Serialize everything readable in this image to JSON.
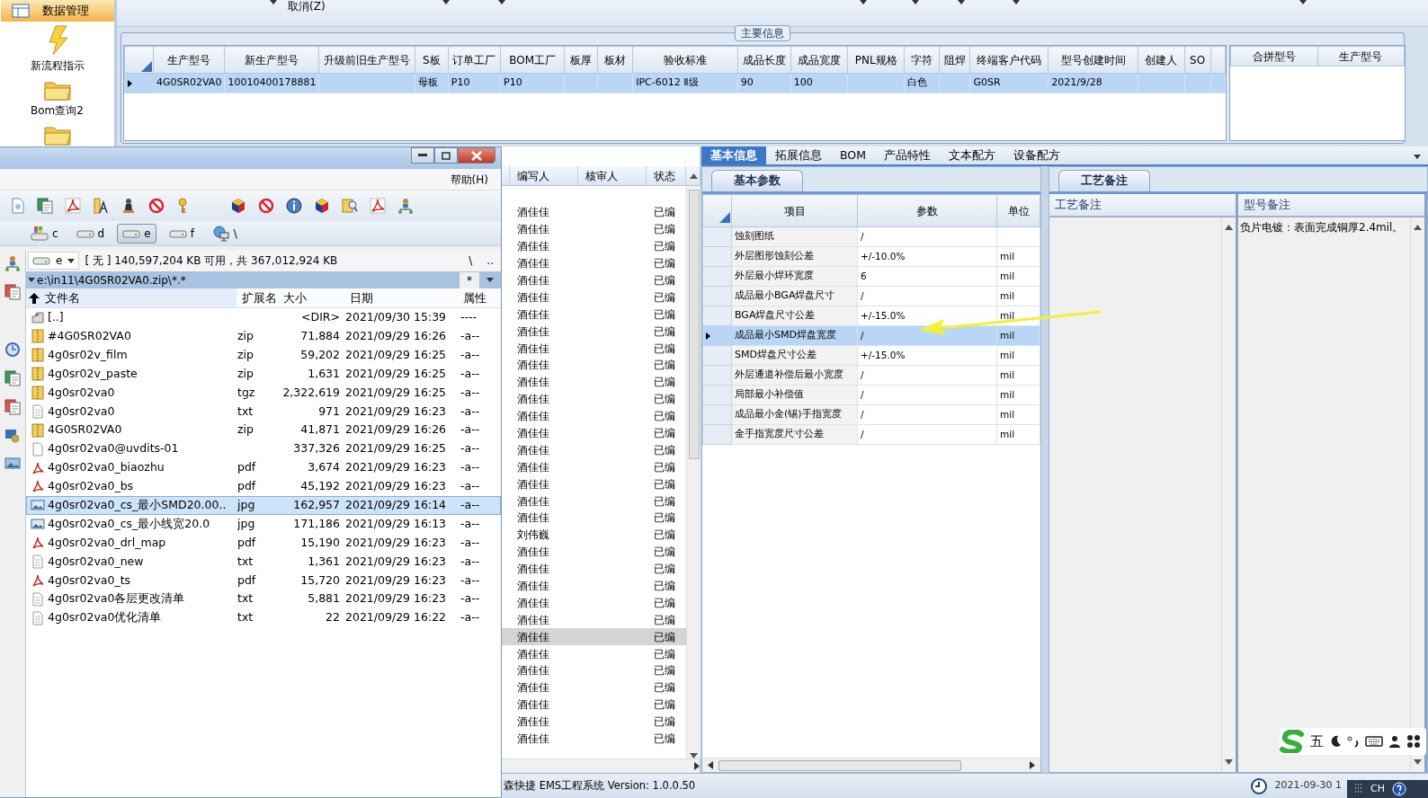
{
  "sidebar": {
    "header": "数据管理",
    "items": [
      {
        "label": "新流程指示",
        "kind": "flash"
      },
      {
        "label": "Bom查询2",
        "kind": "folder"
      },
      {
        "kind": "folder"
      }
    ]
  },
  "toolbar": {
    "buttons": [
      "取消(Z)"
    ]
  },
  "main_info": {
    "title": "主要信息",
    "columns": [
      "生产型号",
      "新生产型号",
      "升级前旧生产型号",
      "S板",
      "订单工厂",
      "BOM工厂",
      "板厚",
      "板材",
      "验收标准",
      "成品长度",
      "成品宽度",
      "PNL规格",
      "字符",
      "阻焊",
      "终端客户代码",
      "型号创建时间",
      "创建人",
      "SO"
    ],
    "rows": [
      {
        "selected": true,
        "cells": [
          "4G0SR02VA0",
          "10010400178881",
          null,
          "母板",
          "P10",
          "P10",
          null,
          null,
          "IPC-6012 Ⅱ级",
          "90",
          "100",
          null,
          "白色",
          null,
          "G0SR",
          "2021/9/28",
          null,
          null
        ]
      }
    ]
  },
  "merge_grid": {
    "columns": [
      "合拼型号",
      "生产型号"
    ]
  },
  "review_list": {
    "columns": [
      "编写人",
      "核审人",
      "状态"
    ],
    "rows": [
      {
        "author": "酒佳佳",
        "status": "已编",
        "selected": false
      },
      {
        "author": "酒佳佳",
        "status": "已编",
        "selected": false
      },
      {
        "author": "酒佳佳",
        "status": "已编",
        "selected": false
      },
      {
        "author": "酒佳佳",
        "status": "已编",
        "selected": false
      },
      {
        "author": "酒佳佳",
        "status": "已编",
        "selected": false
      },
      {
        "author": "酒佳佳",
        "status": "已编",
        "selected": false
      },
      {
        "author": "酒佳佳",
        "status": "已编",
        "selected": false
      },
      {
        "author": "酒佳佳",
        "status": "已编",
        "selected": false
      },
      {
        "author": "酒佳佳",
        "status": "已编",
        "selected": false
      },
      {
        "author": "酒佳佳",
        "status": "已编",
        "selected": false
      },
      {
        "author": "酒佳佳",
        "status": "已编",
        "selected": false
      },
      {
        "author": "酒佳佳",
        "status": "已编",
        "selected": false
      },
      {
        "author": "酒佳佳",
        "status": "已编",
        "selected": false
      },
      {
        "author": "酒佳佳",
        "status": "已编",
        "selected": false
      },
      {
        "author": "酒佳佳",
        "status": "已编",
        "selected": false
      },
      {
        "author": "酒佳佳",
        "status": "已编",
        "selected": false
      },
      {
        "author": "酒佳佳",
        "status": "已编",
        "selected": false
      },
      {
        "author": "酒佳佳",
        "status": "已编",
        "selected": false
      },
      {
        "author": "酒佳佳",
        "status": "已编",
        "selected": false
      },
      {
        "author": "刘伟巍",
        "status": "已编",
        "selected": false
      },
      {
        "author": "酒佳佳",
        "status": "已编",
        "selected": false
      },
      {
        "author": "酒佳佳",
        "status": "已编",
        "selected": false
      },
      {
        "author": "酒佳佳",
        "status": "已编",
        "selected": false
      },
      {
        "author": "酒佳佳",
        "status": "已编",
        "selected": false
      },
      {
        "author": "酒佳佳",
        "status": "已编",
        "selected": false
      },
      {
        "author": "酒佳佳",
        "status": "已编",
        "selected": true
      },
      {
        "author": "酒佳佳",
        "status": "已编",
        "selected": false
      },
      {
        "author": "酒佳佳",
        "status": "已编",
        "selected": false
      },
      {
        "author": "酒佳佳",
        "status": "已编",
        "selected": false
      },
      {
        "author": "酒佳佳",
        "status": "已编",
        "selected": false
      },
      {
        "author": "酒佳佳",
        "status": "已编",
        "selected": false
      },
      {
        "author": "酒佳佳",
        "status": "已编",
        "selected": false
      }
    ]
  },
  "tabs": [
    {
      "label": "基本信息",
      "selected": true
    },
    {
      "label": "拓展信息",
      "selected": false
    },
    {
      "label": "BOM",
      "selected": false
    },
    {
      "label": "产品特性",
      "selected": false
    },
    {
      "label": "文本配方",
      "selected": false
    },
    {
      "label": "设备配方",
      "selected": false
    }
  ],
  "param_panel": {
    "subtab": "基本参数",
    "columns": [
      "项目",
      "参数",
      "单位"
    ],
    "rows": [
      {
        "item": "蚀刻图纸",
        "value": "/",
        "selected": false
      },
      {
        "item": "外层图形蚀刻公差",
        "value": "+/-10.0%",
        "unit": "mil",
        "selected": false
      },
      {
        "item": "外层最小焊环宽度",
        "value": "6",
        "unit": "mil",
        "selected": false
      },
      {
        "item": "成品最小BGA焊盘尺寸",
        "value": "/",
        "unit": "mil",
        "selected": false
      },
      {
        "item": "BGA焊盘尺寸公差",
        "value": "+/-15.0%",
        "unit": "mil",
        "selected": false
      },
      {
        "item": "成品最小SMD焊盘宽度",
        "value": "/",
        "unit": "mil",
        "selected": true
      },
      {
        "item": "SMD焊盘尺寸公差",
        "value": "+/-15.0%",
        "unit": "mil",
        "selected": false
      },
      {
        "item": "外层通道补偿后最小宽度",
        "value": "/",
        "unit": "mil",
        "selected": false
      },
      {
        "item": "局部最小补偿值",
        "value": "/",
        "unit": "mil",
        "selected": false
      },
      {
        "item": "成品最小金(锡)手指宽度",
        "value": "/",
        "unit": "mil",
        "selected": false
      },
      {
        "item": "金手指宽度尺寸公差",
        "value": "/",
        "unit": "mil",
        "selected": false
      }
    ]
  },
  "notes_panel": {
    "tab": "工艺备注",
    "columns": [
      "工艺备注",
      "型号备注"
    ],
    "model_note": "负片电镀：表面完成铜厚2.4mil。"
  },
  "status_bar": {
    "app": "森快捷 EMS工程系统 Version: 1.0.0.50",
    "time": "2021-09-30 1"
  },
  "ime_bar": {
    "mode": "五"
  },
  "tray": {
    "language": "CH"
  },
  "file_manager": {
    "menu": [
      "帮助(H)"
    ],
    "drives": [
      {
        "label": "c",
        "kind": "system",
        "selected": false
      },
      {
        "label": "d",
        "kind": "disk",
        "selected": false
      },
      {
        "label": "e",
        "kind": "disk",
        "selected": true
      },
      {
        "label": "f",
        "kind": "disk",
        "selected": false
      },
      {
        "label": "\\",
        "kind": "network",
        "selected": false
      }
    ],
    "drive_select": "e",
    "free_space": "[ 无 ] 140,597,204 KB 可用，共 367,012,924 KB",
    "nav": [
      "\\",
      ".."
    ],
    "path": "e:\\in11\\4G0SR02VA0.zip\\*.*",
    "filter": "*",
    "columns": [
      "文件名",
      "扩展名",
      "大小",
      "日期",
      "属性"
    ],
    "files": [
      {
        "name": "[..]",
        "kind": "up",
        "size": "<DIR>",
        "date": "2021/09/30 15:39",
        "attr": "----",
        "selected": false
      },
      {
        "name": "#4G0SR02VA0",
        "ext": "zip",
        "kind": "zip",
        "size": "71,884",
        "date": "2021/09/29 16:26",
        "attr": "-a--",
        "selected": false
      },
      {
        "name": "4g0sr02v_film",
        "ext": "zip",
        "kind": "zip",
        "size": "59,202",
        "date": "2021/09/29 16:25",
        "attr": "-a--",
        "selected": false
      },
      {
        "name": "4g0sr02v_paste",
        "ext": "zip",
        "kind": "zip",
        "size": "1,631",
        "date": "2021/09/29 16:25",
        "attr": "-a--",
        "selected": false
      },
      {
        "name": "4g0sr02va0",
        "ext": "tgz",
        "kind": "zip",
        "size": "2,322,619",
        "date": "2021/09/29 16:25",
        "attr": "-a--",
        "selected": false
      },
      {
        "name": "4g0sr02va0",
        "ext": "txt",
        "kind": "txt",
        "size": "971",
        "date": "2021/09/29 16:23",
        "attr": "-a--",
        "selected": false
      },
      {
        "name": "4G0SR02VA0",
        "ext": "zip",
        "kind": "zip",
        "size": "41,871",
        "date": "2021/09/29 16:26",
        "attr": "-a--",
        "selected": false
      },
      {
        "name": "4g0sr02va0@uvdits-01",
        "kind": "file",
        "size": "337,326",
        "date": "2021/09/29 16:25",
        "attr": "-a--",
        "selected": false
      },
      {
        "name": "4g0sr02va0_biaozhu",
        "ext": "pdf",
        "kind": "pdf",
        "size": "3,674",
        "date": "2021/09/29 16:23",
        "attr": "-a--",
        "selected": false
      },
      {
        "name": "4g0sr02va0_bs",
        "ext": "pdf",
        "kind": "pdf",
        "size": "45,192",
        "date": "2021/09/29 16:23",
        "attr": "-a--",
        "selected": false
      },
      {
        "name": "4g0sr02va0_cs_最小SMD20.00..",
        "ext": "jpg",
        "kind": "jpg",
        "size": "162,957",
        "date": "2021/09/29 16:14",
        "attr": "-a--",
        "selected": true
      },
      {
        "name": "4g0sr02va0_cs_最小线宽20.0",
        "ext": "jpg",
        "kind": "jpg",
        "size": "171,186",
        "date": "2021/09/29 16:13",
        "attr": "-a--",
        "selected": false
      },
      {
        "name": "4g0sr02va0_drl_map",
        "ext": "pdf",
        "kind": "pdf",
        "size": "15,190",
        "date": "2021/09/29 16:23",
        "attr": "-a--",
        "selected": false
      },
      {
        "name": "4g0sr02va0_new",
        "ext": "txt",
        "kind": "txt",
        "size": "1,361",
        "date": "2021/09/29 16:23",
        "attr": "-a--",
        "selected": false
      },
      {
        "name": "4g0sr02va0_ts",
        "ext": "pdf",
        "kind": "pdf",
        "size": "15,720",
        "date": "2021/09/29 16:23",
        "attr": "-a--",
        "selected": false
      },
      {
        "name": "4g0sr02va0各层更改清单",
        "ext": "txt",
        "kind": "txt",
        "size": "5,881",
        "date": "2021/09/29 16:23",
        "attr": "-a--",
        "selected": false
      },
      {
        "name": "4g0sr02va0优化清单",
        "ext": "txt",
        "kind": "txt",
        "size": "22",
        "date": "2021/09/29 16:22",
        "attr": "-a--",
        "selected": false
      }
    ]
  }
}
